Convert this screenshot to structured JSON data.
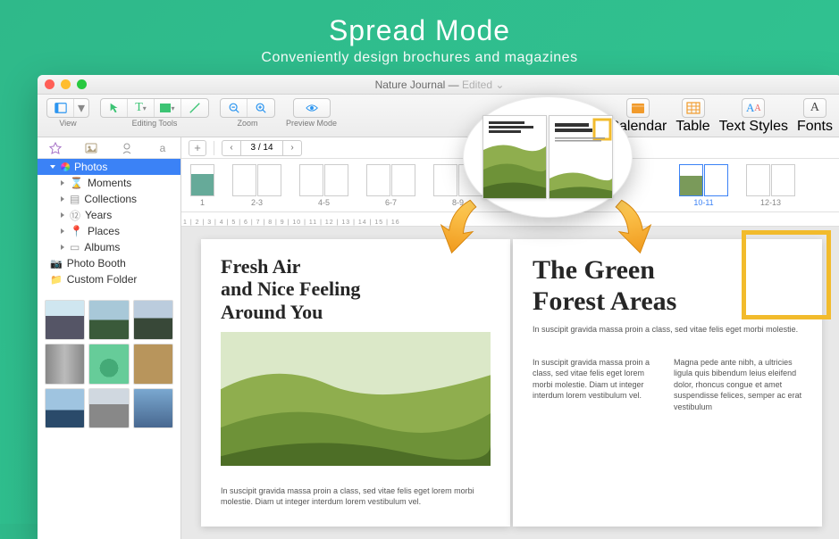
{
  "hero": {
    "title": "Spread Mode",
    "subtitle": "Conveniently design brochures and magazines"
  },
  "window": {
    "doc_name": "Nature Journal",
    "status": "Edited"
  },
  "toolbar": {
    "view": "View",
    "editing": "Editing Tools",
    "zoom": "Zoom",
    "preview": "Preview Mode",
    "calendar": "Calendar",
    "table": "Table",
    "textstyles": "Text Styles",
    "fonts": "Fonts"
  },
  "sidebar": {
    "root": "Photos",
    "items": [
      {
        "label": "Moments"
      },
      {
        "label": "Collections"
      },
      {
        "label": "Years"
      },
      {
        "label": "Places"
      },
      {
        "label": "Albums"
      }
    ],
    "extras": [
      {
        "label": "Photo Booth"
      },
      {
        "label": "Custom Folder"
      }
    ]
  },
  "pager": {
    "value": "3 / 14"
  },
  "spread_labels": [
    "1",
    "2-3",
    "4-5",
    "6-7",
    "8-9",
    "10-11",
    "12-13"
  ],
  "doc": {
    "left_title": "Fresh Air\nand Nice Feeling\nAround You",
    "right_title": "The Green\nForest Areas",
    "p1": "In suscipit gravida massa proin a class, sed vitae felis eget lorem morbi molestie. Diam ut integer interdum lorem vestibulum vel.",
    "p2": "In suscipit gravida massa proin a class, sed vitae felis eget morbi molestie.",
    "p3": "In suscipit gravida massa proin a class, sed vitae felis eget lorem morbi molestie. Diam ut integer interdum lorem vestibulum vel.",
    "p4": "Magna pede ante nibh, a ultricies ligula quis bibendum leius eleifend dolor, rhoncus congue et amet suspendisse felices, semper ac erat vestibulum"
  },
  "ruler": "1 | 2 | 3 | 4 | 5 | 6 | 7 | 8 | 9 | 10 | 11 | 12 | 13 | 14 | 15 | 16"
}
